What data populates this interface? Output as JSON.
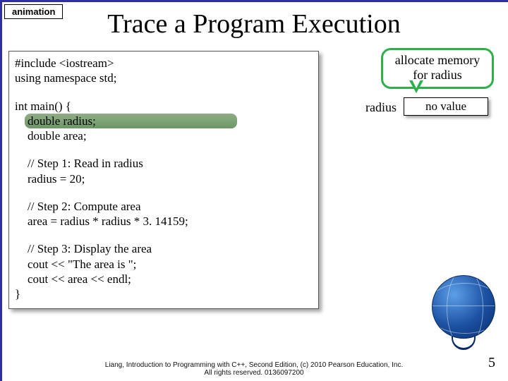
{
  "badge": "animation",
  "title": "Trace a Program Execution",
  "code": {
    "l1": "#include <iostream>",
    "l2": "using namespace std;",
    "l3": "int main() {",
    "l4": "double radius;",
    "l5": "double area;",
    "l6": "// Step 1: Read in radius",
    "l7": "radius = 20;",
    "l8": "// Step 2: Compute area",
    "l9": "area = radius * radius * 3. 14159;",
    "l10": "// Step 3: Display the area",
    "l11": "cout << \"The area is \";",
    "l12": "cout << area << endl;",
    "l13": "}"
  },
  "callout": {
    "line1": "allocate memory",
    "line2": "for radius"
  },
  "memory": {
    "var_name": "radius",
    "var_value": "no value"
  },
  "footer": {
    "line1": "Liang, Introduction to Programming with C++, Second Edition, (c) 2010 Pearson Education, Inc.",
    "line2": "All rights reserved. 0136097200"
  },
  "page_number": "5"
}
